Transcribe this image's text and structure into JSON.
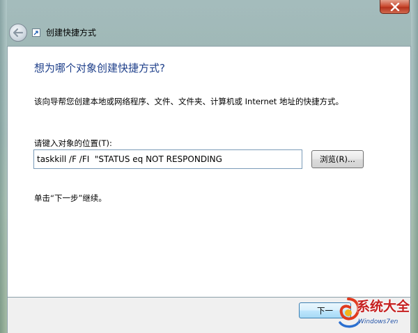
{
  "window": {
    "title": "创建快捷方式"
  },
  "wizard": {
    "heading": "想为哪个对象创建快捷方式?",
    "description": "该向导帮您创建本地或网络程序、文件、文件夹、计算机或 Internet 地址的快捷方式。",
    "location_label": "请键入对象的位置(T):",
    "location_value": "taskkill /F /FI  \"STATUS eq NOT RESPONDING",
    "browse_label": "浏览(R)...",
    "continue_text": "单击“下一步”继续。",
    "next_label": "下一"
  },
  "watermark": {
    "brand_text": "系统大全",
    "url_text": "Windows7en"
  },
  "colors": {
    "heading": "#1e3f8a",
    "close_button": "#c9472d",
    "next_button_border": "#3c7fb1",
    "watermark_brand": "#c62020"
  }
}
